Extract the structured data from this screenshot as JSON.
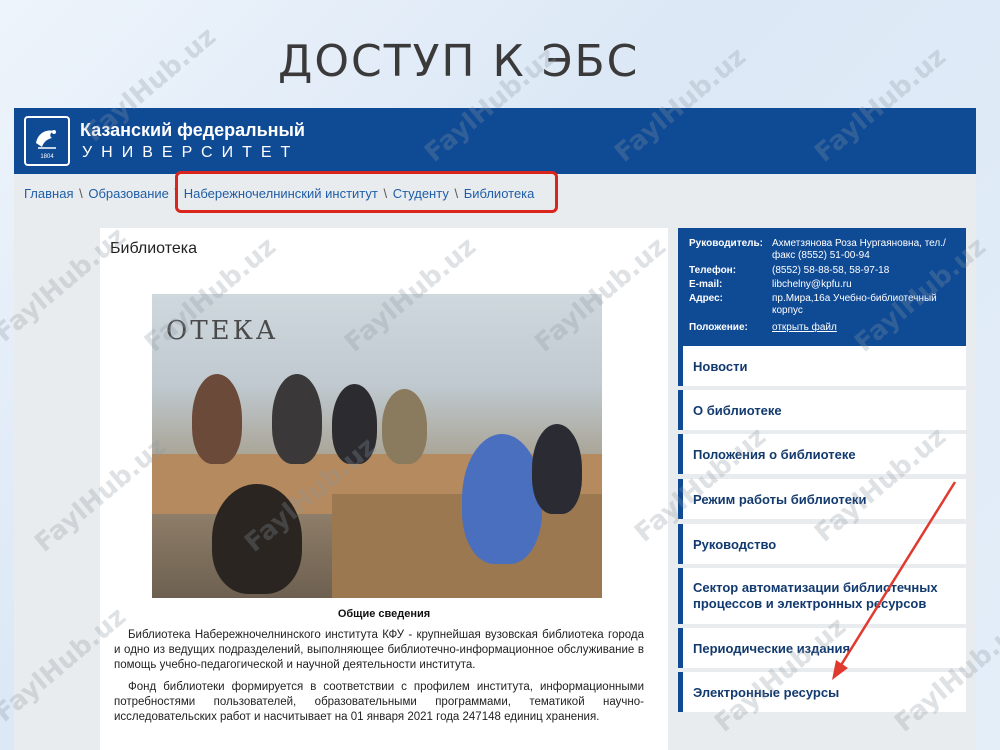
{
  "slide": {
    "title": "ДОСТУП К ЭБС"
  },
  "header": {
    "logo_line1": "Казанский федеральный",
    "logo_line2": "УНИВЕРСИТЕТ",
    "logo_year": "1804"
  },
  "breadcrumb": [
    "Главная",
    "Образование",
    "Набережночелнинский институт",
    "Студенту",
    "Библиотека"
  ],
  "content": {
    "heading": "Библиотека",
    "photo_wall_text": "ОТЕКА",
    "general_heading": "Общие сведения",
    "para1": "Библиотека Набережночелнинского института КФУ - крупнейшая вузовская библиотека города и одно из ведущих подразделений, выполняющее библиотечно-информационное обслуживание в помощь учебно-педагогической и научной деятельности института.",
    "para2": "Фонд библиотеки формируется в соответствии с профилем института, информационными потребностями пользователей, образовательными программами, тематикой научно-исследовательских работ и насчитывает на 01 января 2021 года 247148 единиц хранения."
  },
  "info": {
    "head_label": "Руководитель:",
    "head_value": "Ахметзянова Роза Нургаяновна, тел./факс (8552) 51-00-94",
    "phone_label": "Телефон:",
    "phone_value": "(8552) 58-88-58, 58-97-18",
    "email_label": "E-mail:",
    "email_value": "libchelny@kpfu.ru",
    "address_label": "Адрес:",
    "address_value": "пр.Мира,16а Учебно-библиотечный корпус",
    "regulation_label": "Положение:",
    "regulation_value": "открыть файл"
  },
  "menu": [
    "Новости",
    "О библиотеке",
    "Положения о библиотеке",
    "Режим работы библиотеки",
    "Руководство",
    "Сектор автоматизации библиотечных процессов и электронных ресурсов",
    "Периодические издания",
    "Электронные ресурсы"
  ],
  "watermark": "FaylHub.uz",
  "colors": {
    "header_blue": "#0f4a95",
    "link_blue": "#1f5ea6",
    "highlight_red": "#d9251c",
    "arrow_red": "#e03a2f"
  }
}
